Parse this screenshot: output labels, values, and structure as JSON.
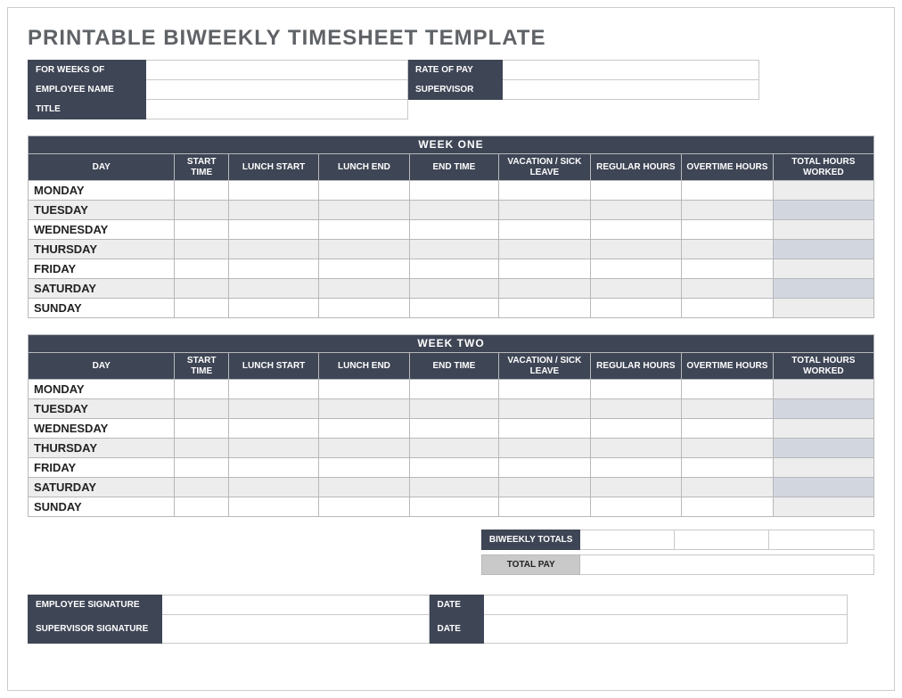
{
  "title": "PRINTABLE BIWEEKLY TIMESHEET TEMPLATE",
  "info": {
    "for_weeks_of_label": "FOR WEEKS OF",
    "for_weeks_of": "",
    "rate_of_pay_label": "RATE OF PAY",
    "rate_of_pay": "",
    "employee_name_label": "EMPLOYEE NAME",
    "employee_name": "",
    "supervisor_label": "SUPERVISOR",
    "supervisor": "",
    "title_label": "TITLE",
    "title": ""
  },
  "columns": {
    "day": "DAY",
    "start_time": "START TIME",
    "lunch_start": "LUNCH START",
    "lunch_end": "LUNCH END",
    "end_time": "END TIME",
    "vacation_sick": "VACATION / SICK LEAVE",
    "regular_hours": "REGULAR HOURS",
    "overtime_hours": "OVERTIME HOURS",
    "total_hours": "TOTAL HOURS WORKED"
  },
  "week_one": {
    "title": "WEEK ONE",
    "rows": [
      {
        "day": "MONDAY"
      },
      {
        "day": "TUESDAY"
      },
      {
        "day": "WEDNESDAY"
      },
      {
        "day": "THURSDAY"
      },
      {
        "day": "FRIDAY"
      },
      {
        "day": "SATURDAY"
      },
      {
        "day": "SUNDAY"
      }
    ]
  },
  "week_two": {
    "title": "WEEK TWO",
    "rows": [
      {
        "day": "MONDAY"
      },
      {
        "day": "TUESDAY"
      },
      {
        "day": "WEDNESDAY"
      },
      {
        "day": "THURSDAY"
      },
      {
        "day": "FRIDAY"
      },
      {
        "day": "SATURDAY"
      },
      {
        "day": "SUNDAY"
      }
    ]
  },
  "summary": {
    "biweekly_totals_label": "BIWEEKLY TOTALS",
    "total_pay_label": "TOTAL PAY",
    "regular": "",
    "overtime": "",
    "total": "",
    "pay_value": ""
  },
  "sigs": {
    "employee_sig_label": "EMPLOYEE SIGNATURE",
    "supervisor_sig_label": "SUPERVISOR SIGNATURE",
    "date_label": "DATE",
    "employee_sig": "",
    "employee_date": "",
    "supervisor_sig": "",
    "supervisor_date": ""
  }
}
